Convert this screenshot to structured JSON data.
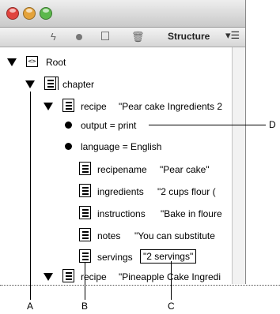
{
  "toolbar": {
    "panel_title": "Structure"
  },
  "tree": {
    "root_label": "Root",
    "chapter_label": "chapter",
    "recipe1": {
      "name": "recipe",
      "value": "\"Pear cake Ingredients 2"
    },
    "output": "output = print",
    "language": "language = English",
    "recipename": {
      "name": "recipename",
      "value": "\"Pear cake\""
    },
    "ingredients": {
      "name": "ingredients",
      "value": "\"2 cups flour ("
    },
    "instructions": {
      "name": "instructions",
      "value": "\"Bake in floure"
    },
    "notes": {
      "name": "notes",
      "value": "\"You can substitute"
    },
    "servings": {
      "name": "servings",
      "value": "\"2 servings\""
    },
    "recipe2": {
      "name": "recipe",
      "value": "\"Pineapple Cake Ingredi"
    }
  },
  "callouts": {
    "a": "A",
    "b": "B",
    "c": "C",
    "d": "D"
  },
  "icons": [
    "close-light-icon",
    "minimize-light-icon",
    "zoom-light-icon",
    "lightning-icon",
    "bullet-dot-icon",
    "frame-icon",
    "trash-icon",
    "panel-menu-icon"
  ]
}
